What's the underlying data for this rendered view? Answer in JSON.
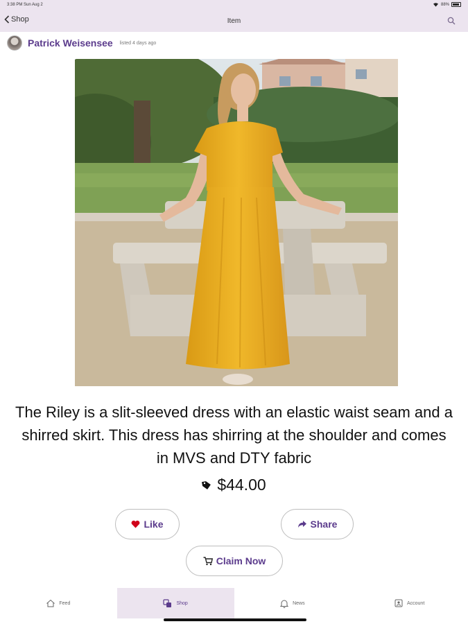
{
  "status_bar": {
    "time": "3:38 PM  Sun Aug 2",
    "battery": "88%"
  },
  "nav": {
    "back_label": "Shop",
    "title": "Item"
  },
  "seller": {
    "name": "Patrick Weisensee",
    "listed": "listed 4 days ago"
  },
  "product": {
    "description": "The Riley is a slit-sleeved dress with an elastic waist seam and a shirred skirt. This dress has shirring at the shoulder and comes in MVS and DTY fabric",
    "price": "$44.00"
  },
  "actions": {
    "like_label": "Like",
    "share_label": "Share",
    "claim_label": "Claim Now"
  },
  "tabs": [
    {
      "label": "Feed",
      "icon": "home-icon"
    },
    {
      "label": "Shop",
      "icon": "shop-icon",
      "active": true
    },
    {
      "label": "News",
      "icon": "bell-icon"
    },
    {
      "label": "Account",
      "icon": "account-icon"
    }
  ],
  "colors": {
    "accent": "#5b3b8c",
    "bar_bg": "#ece4ef",
    "heart": "#d0021b"
  }
}
